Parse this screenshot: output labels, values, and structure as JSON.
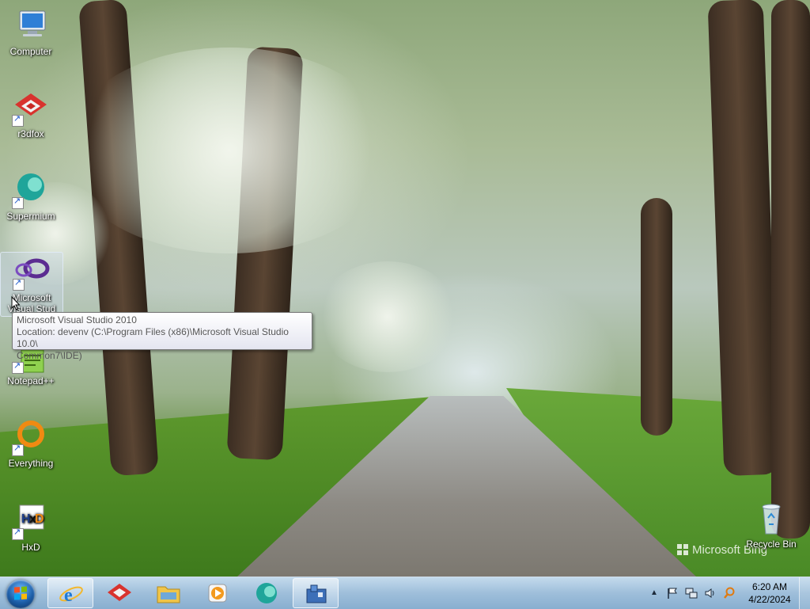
{
  "desktop": {
    "icons": [
      {
        "label": "Computer",
        "icon": "computer-icon",
        "shortcut": false
      },
      {
        "label": "r3dfox",
        "icon": "r3dfox-icon",
        "shortcut": true
      },
      {
        "label": "Supermium",
        "icon": "supermium-icon",
        "shortcut": true
      },
      {
        "label": "Microsoft Visual Studio 2010",
        "icon": "visual-studio-icon",
        "shortcut": true,
        "selected": true
      },
      {
        "label": "Notepad++",
        "icon": "notepadpp-icon",
        "shortcut": true
      },
      {
        "label": "Everything",
        "icon": "everything-icon",
        "shortcut": true
      },
      {
        "label": "HxD",
        "icon": "hxd-icon",
        "shortcut": true
      },
      {
        "label": "Recycle Bin",
        "icon": "recycle-bin-icon",
        "shortcut": false
      }
    ],
    "visible_labels": {
      "computer": "Computer",
      "r3dfox": "r3dfox",
      "supermium": "Supermium",
      "vs_line1": "Microsoft",
      "vs_line2": "Visual Stud",
      "notepadpp": "Notepad++",
      "everything": "Everything",
      "hxd": "HxD",
      "recycle": "Recycle Bin"
    },
    "watermark": "Microsoft Bing"
  },
  "tooltip": {
    "line1": "Microsoft Visual Studio 2010",
    "line2": "Location: devenv (C:\\Program Files (x86)\\Microsoft Visual Studio 10.0\\",
    "line3": "Common7\\IDE)"
  },
  "taskbar": {
    "pinned": [
      {
        "name": "internet-explorer",
        "icon": "internet-explorer-icon",
        "active": true
      },
      {
        "name": "r3dfox",
        "icon": "r3dfox-icon",
        "active": false
      },
      {
        "name": "windows-explorer",
        "icon": "folder-icon",
        "active": false
      },
      {
        "name": "media-player",
        "icon": "media-player-icon",
        "active": false
      },
      {
        "name": "supermium",
        "icon": "supermium-icon",
        "active": false
      },
      {
        "name": "unknown-app",
        "icon": "app-icon",
        "active": true
      }
    ],
    "tray_icons": [
      "show-hidden-icons-icon",
      "action-center-flag-icon",
      "network-icon",
      "volume-icon",
      "search-tray-icon"
    ],
    "clock": {
      "time": "6:20 AM",
      "date": "4/22/2024"
    }
  },
  "colors": {
    "taskbar": "#9ab8d6",
    "tooltip_border": "#767676",
    "tooltip_text": "#575757"
  }
}
